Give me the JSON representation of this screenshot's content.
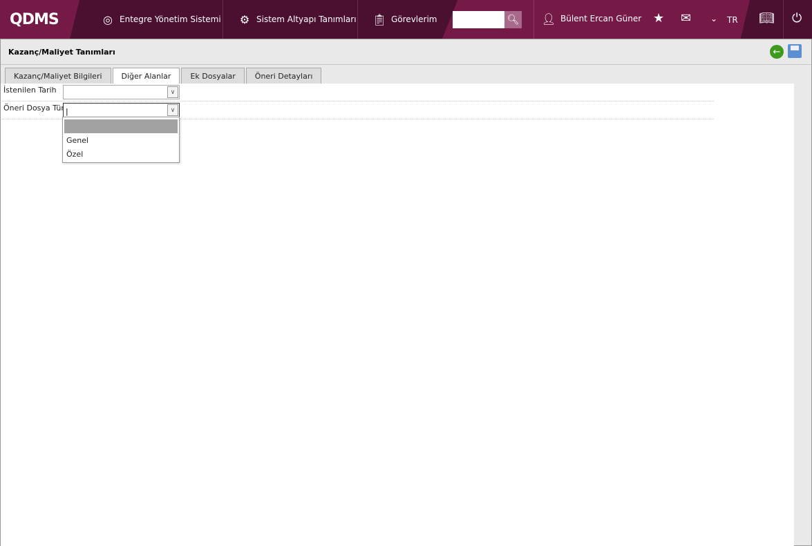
{
  "nav": {
    "logo": "QDMS",
    "items": [
      {
        "label": "Entegre Yönetim Sistemi"
      },
      {
        "label": "Sistem Altyapı Tanımları"
      },
      {
        "label": "Görevlerim"
      }
    ],
    "search_value": "",
    "user": "Bülent Ercan Güner",
    "language": "TR"
  },
  "page": {
    "title": "Kazanç/Maliyet Tanımları",
    "tabs": [
      "Kazanç/Maliyet Bilgileri",
      "Diğer Alanlar",
      "Ek Dosyalar",
      "Öneri Detayları"
    ],
    "active_tab": "Diğer Alanlar"
  },
  "form": {
    "fields": [
      {
        "label": "İstenilen Tarih",
        "value": ""
      },
      {
        "label": "Öneri Dosya Türü",
        "value": "|"
      }
    ],
    "dropdown_options": [
      "",
      "Genel",
      "Özel"
    ]
  }
}
